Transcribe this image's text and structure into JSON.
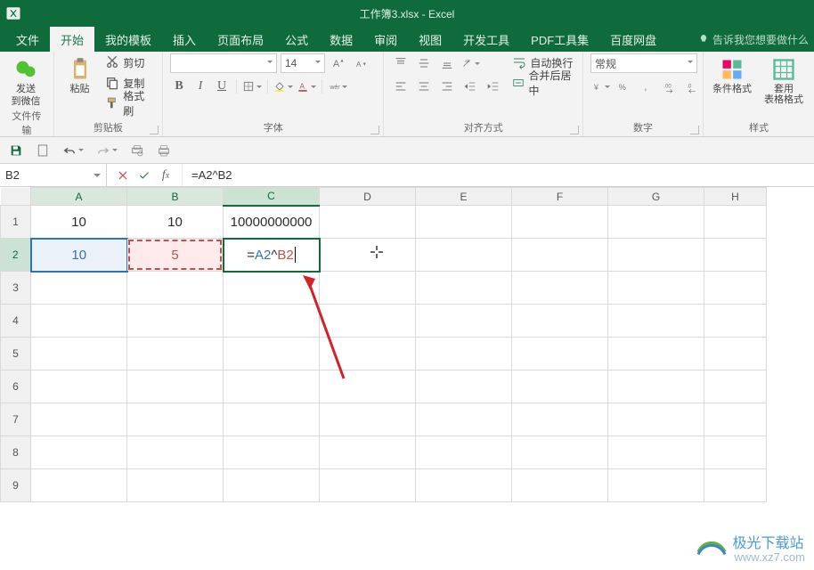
{
  "title": "工作簿3.xlsx - Excel",
  "tabs": [
    "文件",
    "开始",
    "我的模板",
    "插入",
    "页面布局",
    "公式",
    "数据",
    "审阅",
    "视图",
    "开发工具",
    "PDF工具集",
    "百度网盘"
  ],
  "active_tab_index": 1,
  "tell_me": "告诉我您想要做什么",
  "groups": {
    "wechat": {
      "send": "发送",
      "to": "到微信",
      "label": "文件传输"
    },
    "clipboard": {
      "paste": "粘贴",
      "cut": "剪切",
      "copy": "复制",
      "painter": "格式刷",
      "label": "剪贴板"
    },
    "font": {
      "name": "",
      "size": "14",
      "label": "字体"
    },
    "align": {
      "wrap": "自动换行",
      "merge": "合并后居中",
      "label": "对齐方式"
    },
    "number": {
      "format": "常规",
      "label": "数字"
    },
    "styles": {
      "cond": "条件格式",
      "table": "套用\n表格格式",
      "label": "样式"
    }
  },
  "name_box": "B2",
  "formula_bar": "=A2^B2",
  "columns": [
    "A",
    "B",
    "C",
    "D",
    "E",
    "F",
    "G",
    "H"
  ],
  "rows": [
    1,
    2,
    3,
    4,
    5,
    6,
    7,
    8,
    9
  ],
  "cells": {
    "A1": "10",
    "B1": "10",
    "C1": "10000000000",
    "A2": "10",
    "B2": "5",
    "C2_prefix": "=",
    "C2_refA": "A2",
    "C2_op": "^",
    "C2_refB": "B2"
  },
  "watermark": {
    "cn": "极光下载站",
    "url": "www.xz7.com"
  }
}
